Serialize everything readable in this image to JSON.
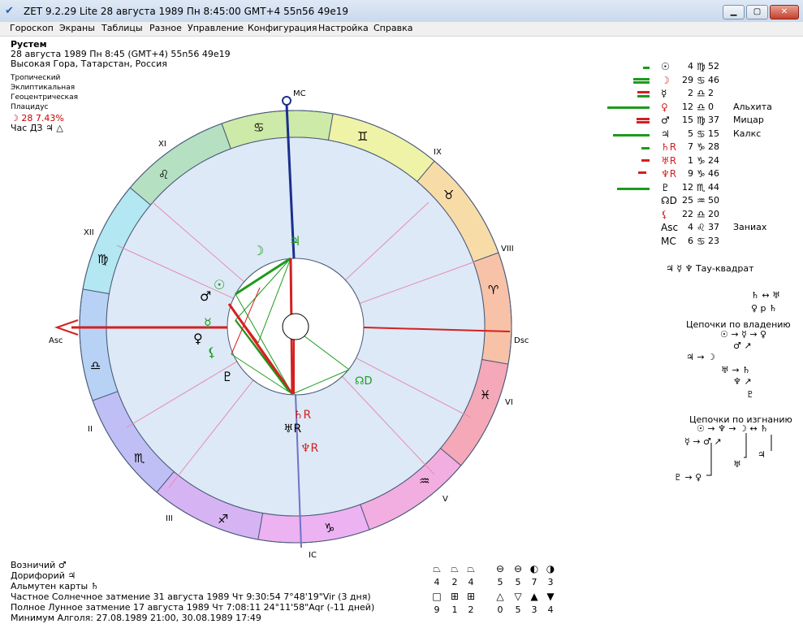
{
  "window": {
    "title": "ZET 9.2.29 Lite  28 августа 1989  Пн  8:45:00 GMT+4 55n56  49e19",
    "min_icon": "minimize-icon",
    "max_icon": "maximize-icon",
    "close_icon": "close-icon",
    "min_glyph": "▁",
    "max_glyph": "▢",
    "close_glyph": "✕"
  },
  "menu": [
    "Гороскоп",
    "Экраны",
    "Таблицы",
    "Разное",
    "Управление",
    "Конфигурация",
    "Настройка",
    "Справка"
  ],
  "info": {
    "name": "Рустем",
    "datetime": "28 августа 1989  Пн   8:45 (GMT+4)  55n56  49e19",
    "place": "Высокая Гора, Татарстан, Россия",
    "zodiac": "Тропический",
    "coords": "Эклиптикальная",
    "centric": "Геоцентрическая",
    "houses": "Плацидус",
    "moon_line": "☽ 28 7.43%",
    "hour_line": "Час ДЗ ♃ △"
  },
  "wheel": {
    "mc": "MC",
    "ic": "IC",
    "asc": "Asc",
    "dsc": "Dsc",
    "house_numbers": [
      "XI",
      "IX",
      "XII",
      "VIII",
      "II",
      "VI",
      "III",
      "V"
    ],
    "signs": [
      "♋",
      "♊",
      "♌",
      "♉",
      "♍",
      "♈",
      "♎",
      "♓",
      "♏",
      "♒",
      "♐",
      "♑"
    ],
    "planets": {
      "moon": "☽",
      "jupiter": "♃",
      "sun": "☉",
      "mars": "♂",
      "mercury": "☿",
      "venus": "♀",
      "lilith": "⚸",
      "pluto": "♇",
      "node": "☊D",
      "saturn": "♄R",
      "uranus": "♅R",
      "neptune": "♆R"
    },
    "colors": {
      "axis_red": "#d42020",
      "axis_blue": "#1b2f8f",
      "aspect_green": "#1d9a1d"
    }
  },
  "planet_table": [
    {
      "glyph": "☉",
      "deg": "4",
      "sign": "♍",
      "min": "52",
      "name": ""
    },
    {
      "glyph": "☽",
      "deg": "29",
      "sign": "♋",
      "min": "46",
      "name": ""
    },
    {
      "glyph": "☿",
      "deg": "2",
      "sign": "♎",
      "min": "2",
      "name": ""
    },
    {
      "glyph": "♀",
      "deg": "12",
      "sign": "♎",
      "min": "0",
      "name": "Альхита"
    },
    {
      "glyph": "♂",
      "deg": "15",
      "sign": "♍",
      "min": "37",
      "name": "Мицар"
    },
    {
      "glyph": "♃",
      "deg": "5",
      "sign": "♋",
      "min": "15",
      "name": "Калкс"
    },
    {
      "glyph": "♄R",
      "deg": "7",
      "sign": "♑",
      "min": "28",
      "name": ""
    },
    {
      "glyph": "♅R",
      "deg": "1",
      "sign": "♑",
      "min": "24",
      "name": ""
    },
    {
      "glyph": "♆R",
      "deg": "9",
      "sign": "♑",
      "min": "46",
      "name": ""
    },
    {
      "glyph": "♇",
      "deg": "12",
      "sign": "♏",
      "min": "44",
      "name": ""
    },
    {
      "glyph": "☊D",
      "deg": "25",
      "sign": "♒",
      "min": "50",
      "name": ""
    },
    {
      "glyph": "⚸",
      "deg": "22",
      "sign": "♎",
      "min": "20",
      "name": ""
    },
    {
      "glyph": "Asc",
      "deg": "4",
      "sign": "♌",
      "min": "37",
      "name": "Заниах"
    },
    {
      "glyph": "MC",
      "deg": "6",
      "sign": "♋",
      "min": "23",
      "name": ""
    }
  ],
  "right_panel": {
    "tau_square": "♃ ☿ ♆  Тау-квадрат",
    "rel1": "♄ ↔ ♅",
    "rel2": "♀ p ♄",
    "chains_title": "Цепочки по владению",
    "chain1": "☉ → ☿ → ♀",
    "chain2": "♂ ↗",
    "chain3": "♃ → ☽",
    "chain4": "♅ → ♄",
    "chain5": "♆ ↗",
    "chain6": "♇",
    "exile_title": "Цепочки по изгнанию",
    "exile1": "☉ → ♆ → ☽ ↔ ♄",
    "exile2": "☿ → ♂ ↗",
    "exile3": "♃",
    "exile4": "♅",
    "exile5": "♇ → ♀"
  },
  "bottom": {
    "l1": "Возничий  ♂",
    "l2": "Дорифорий  ♃",
    "l3": "Альмутен карты  ♄",
    "l4": "Частное Солнечное затмение 31 августа 1989 Чт  9:30:54  7°48'19\"Vir (3 дня)",
    "l5": "Полное Лунное затмение 17 августа 1989 Чт  7:08:11 24°11'58\"Aqr (-11 дней)",
    "l6": "Минимум Алголя: 27.08.1989 21:00,  30.08.1989 17:49"
  },
  "stats": {
    "row1_syms": [
      "⏢",
      "⏢",
      "⏢",
      "⊖",
      "⊖",
      "◐",
      "◑"
    ],
    "row1_nums": [
      "4",
      "2",
      "4",
      "5",
      "5",
      "7",
      "3"
    ],
    "row2_syms": [
      "□",
      "⊞",
      "⊞",
      "△",
      "▽",
      "▲",
      "▼"
    ],
    "row2_nums": [
      "9",
      "1",
      "2",
      "0",
      "5",
      "3",
      "4"
    ]
  }
}
